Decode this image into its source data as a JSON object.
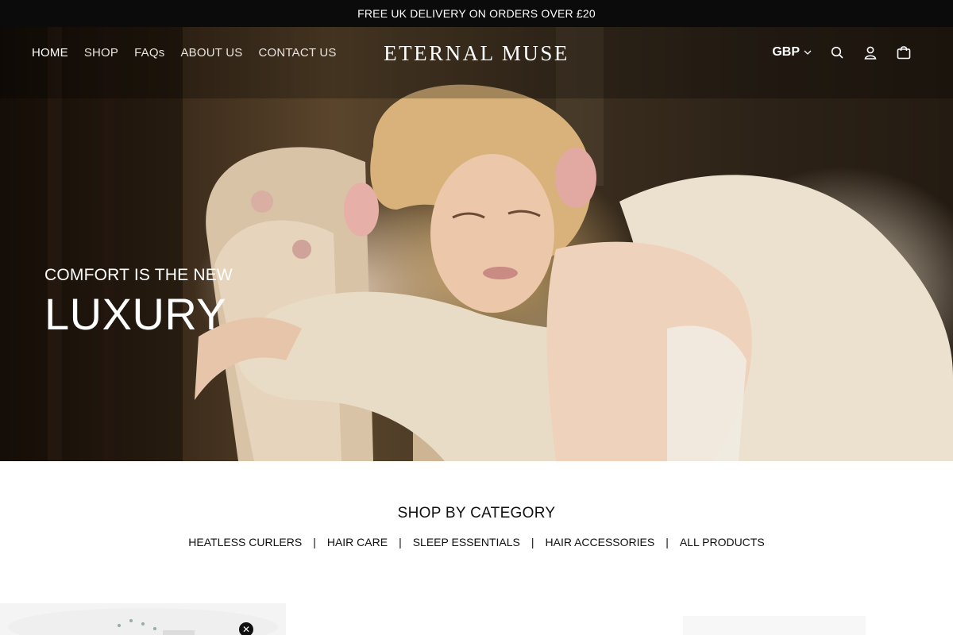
{
  "announcement": "FREE UK DELIVERY ON ORDERS OVER £20",
  "nav": {
    "items": [
      {
        "label": "HOME"
      },
      {
        "label": "SHOP"
      },
      {
        "label": "FAQs"
      },
      {
        "label": "ABOUT US"
      },
      {
        "label": "CONTACT US"
      }
    ]
  },
  "brand": "ETERNAL MUSE",
  "header": {
    "currency": "GBP",
    "icons": [
      "search-icon",
      "account-icon",
      "cart-icon"
    ]
  },
  "hero": {
    "tagline_small": "COMFORT IS THE NEW",
    "tagline_big": "LUXURY"
  },
  "categories": {
    "title": "SHOP BY CATEGORY",
    "links": [
      "HEATLESS CURLERS",
      "HAIR CARE",
      "SLEEP ESSENTIALS",
      "HAIR ACCESSORIES",
      "ALL PRODUCTS"
    ],
    "separator": "|"
  },
  "popup": {
    "close_icon": "close-icon"
  }
}
